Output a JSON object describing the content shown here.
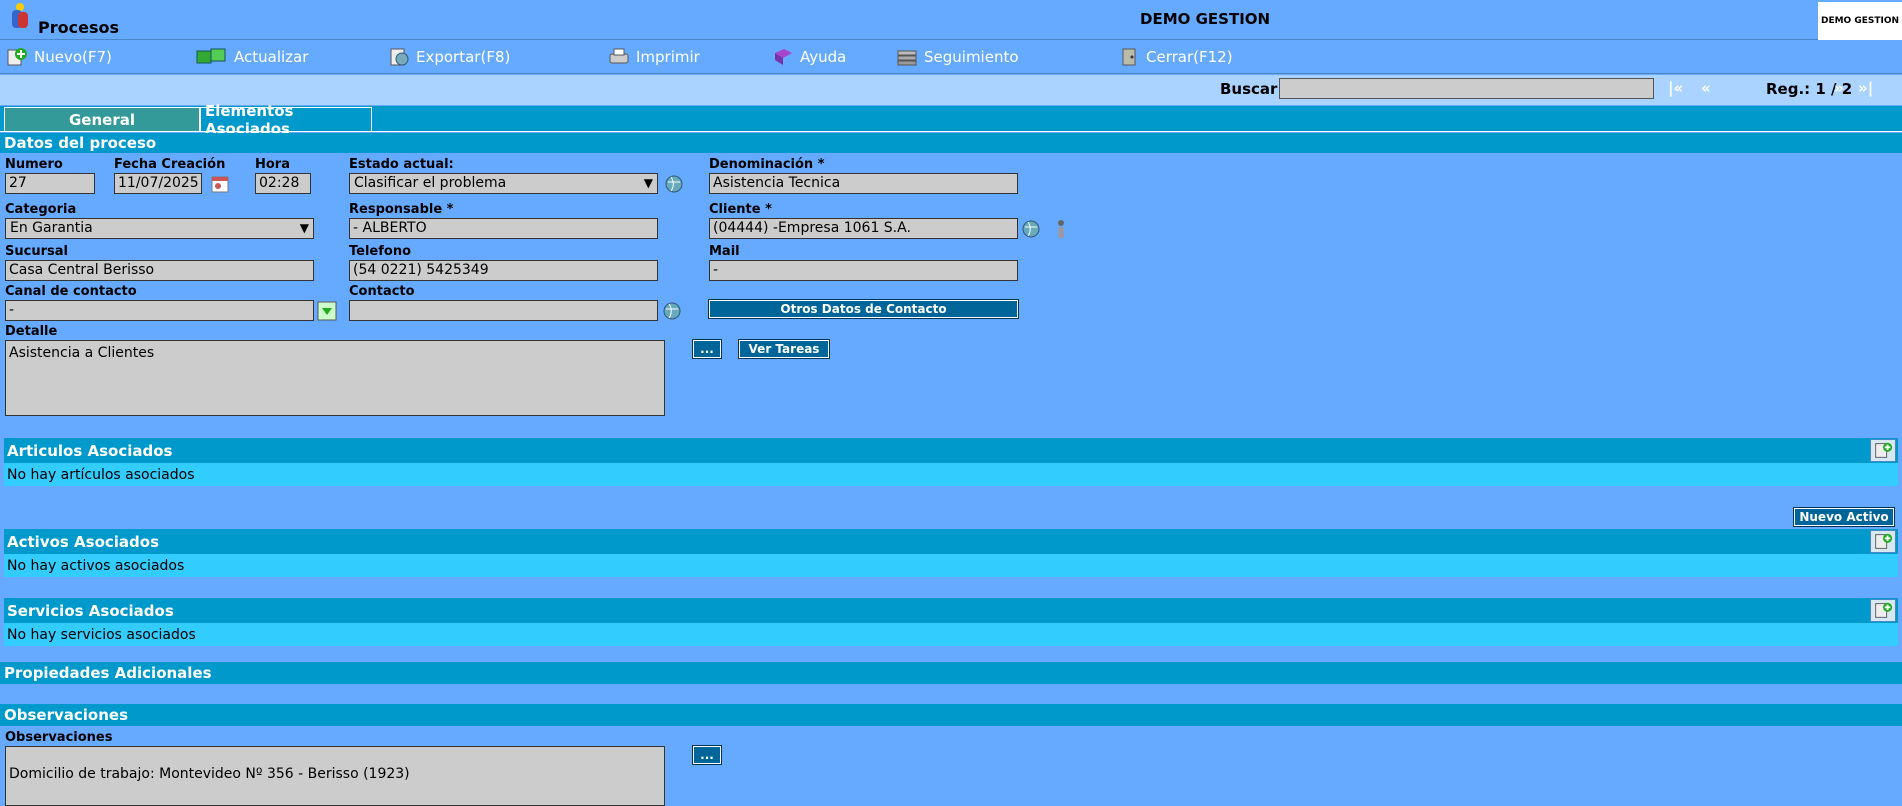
{
  "header": {
    "app_title": "Procesos",
    "company_name": "DEMO GESTION",
    "company_logo_text": "DEMO GESTION"
  },
  "toolbar": {
    "nuevo": "Nuevo(F7)",
    "actualizar": "Actualizar",
    "exportar": "Exportar(F8)",
    "imprimir": "Imprimir",
    "ayuda": "Ayuda",
    "seguimiento": "Seguimiento",
    "cerrar": "Cerrar(F12)"
  },
  "search": {
    "label": "Buscar",
    "value": "",
    "nav_first": "|«",
    "nav_prev": "«",
    "reg_label": "Reg.: 1 / 2",
    "nav_next": "»",
    "nav_last": "»|"
  },
  "tabs": {
    "general": "General",
    "elementos": "Elementos Asociados"
  },
  "sections": {
    "datos": "Datos del proceso",
    "articulos": "Articulos Asociados",
    "articulos_empty": "No hay artículos asociados",
    "activos": "Activos Asociados",
    "activos_empty": "No hay activos asociados",
    "nuevo_activo": "Nuevo Activo",
    "servicios": "Servicios Asociados",
    "servicios_empty": "No hay servicios asociados",
    "propiedades": "Propiedades Adicionales",
    "observaciones": "Observaciones"
  },
  "form": {
    "numero_label": "Numero",
    "numero": "27",
    "fecha_label": "Fecha Creación",
    "fecha": "11/07/2025",
    "hora_label": "Hora",
    "hora": "02:28",
    "estado_label": "Estado actual:",
    "estado": "Clasificar el problema",
    "denominacion_label": "Denominación *",
    "denominacion": "Asistencia Tecnica",
    "categoria_label": "Categoria",
    "categoria": "En Garantia",
    "responsable_label": "Responsable *",
    "responsable": "- ALBERTO",
    "cliente_label": "Cliente *",
    "cliente": "(04444) -Empresa 1061 S.A.",
    "sucursal_label": "Sucursal",
    "sucursal": "Casa Central Berisso",
    "telefono_label": "Telefono",
    "telefono": "(54 0221) 5425349",
    "mail_label": "Mail",
    "mail": "-",
    "canal_label": "Canal de contacto",
    "canal": "-",
    "contacto_label": "Contacto",
    "contacto": "",
    "otros_datos": "Otros Datos de Contacto",
    "detalle_label": "Detalle",
    "detalle": "Asistencia a Clientes",
    "dots": "...",
    "ver_tareas": "Ver Tareas",
    "observaciones_label": "Observaciones",
    "observaciones": "Domicilio de trabajo: Montevideo Nº 356 - Berisso (1923)",
    "obs_dots": "..."
  }
}
